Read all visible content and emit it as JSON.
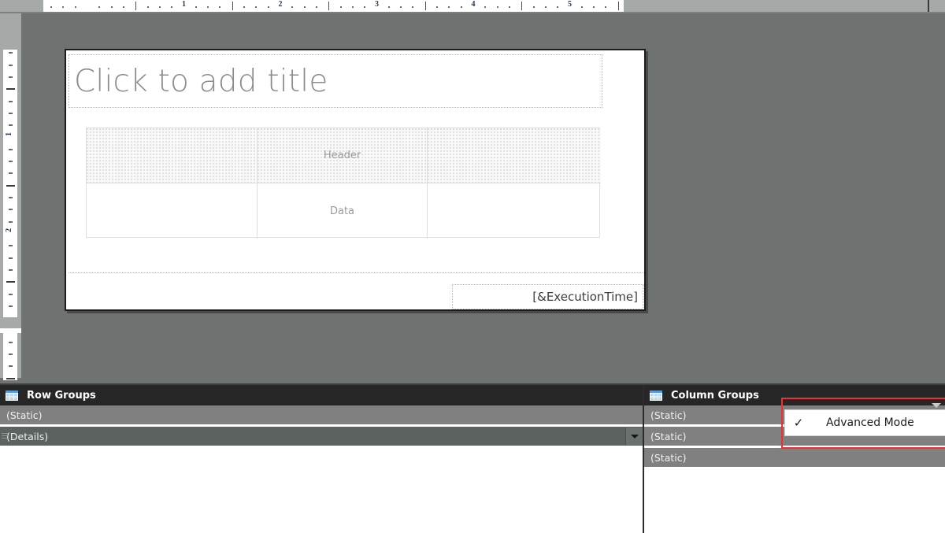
{
  "rulers": {
    "horizontal": {
      "numbers": [
        1,
        2,
        3,
        4,
        5
      ],
      "unit": "inches"
    },
    "vertical": {
      "numbers": [
        1,
        2
      ],
      "unit": "inches"
    }
  },
  "report": {
    "title_placeholder": "Click to add title",
    "tablix": {
      "cells": [
        {
          "text": "",
          "kind": "header"
        },
        {
          "text": "Header",
          "kind": "header"
        },
        {
          "text": "",
          "kind": "header"
        },
        {
          "text": "",
          "kind": "data"
        },
        {
          "text": "Data",
          "kind": "data"
        },
        {
          "text": "",
          "kind": "data"
        }
      ]
    },
    "footer": {
      "execution_time": "[&ExecutionTime]"
    }
  },
  "row_groups": {
    "title": "Row Groups",
    "icon": "grid-table-icon",
    "rows": [
      {
        "label": "(Static)",
        "kind": "static",
        "has_dropdown": false,
        "has_handle": false
      },
      {
        "label": "(Details)",
        "kind": "details",
        "has_dropdown": true,
        "has_handle": true
      }
    ]
  },
  "column_groups": {
    "title": "Column Groups",
    "icon": "grid-table-icon",
    "rows": [
      {
        "label": "(Static)",
        "kind": "static",
        "has_dropdown": false,
        "has_handle": false
      },
      {
        "label": "(Static)",
        "kind": "static",
        "has_dropdown": false,
        "has_handle": false
      },
      {
        "label": "(Static)",
        "kind": "static",
        "has_dropdown": false,
        "has_handle": false
      }
    ],
    "menu": {
      "caret_icon": "chevron-down-icon",
      "items": [
        {
          "label": "Advanced Mode",
          "checked": true,
          "check_glyph": "✓"
        }
      ],
      "highlight_color": "#f03030"
    }
  },
  "colors": {
    "canvas": "#6e7271",
    "ruler_band": "#a5aaa8",
    "panel_header": "#262626",
    "static_row": "#808080",
    "details_row": "#5c625f",
    "highlight": "#f03030"
  }
}
